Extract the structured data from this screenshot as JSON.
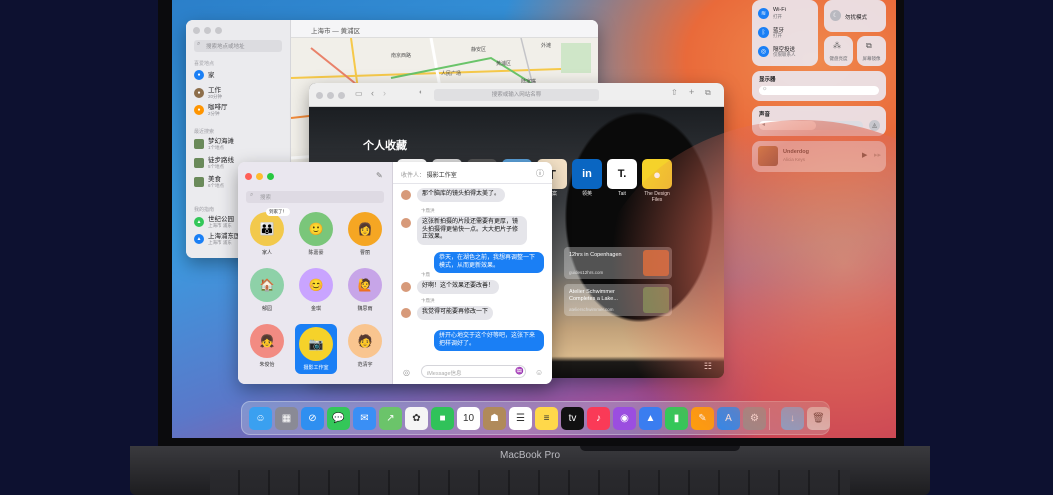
{
  "device": {
    "brand": "MacBook Pro"
  },
  "maps": {
    "search_placeholder": "搜索地点或地址",
    "title": "上海市 — 黄浦区",
    "sections": [
      "喜爱地点",
      "最近搜索",
      "我的指南"
    ],
    "favorites": [
      {
        "name": "家",
        "sub": "",
        "color": "#1a7ff5"
      },
      {
        "name": "工作",
        "sub": "20分钟",
        "color": "#8d6e4a"
      },
      {
        "name": "咖啡厅",
        "sub": "2分钟",
        "color": "#ff9500"
      }
    ],
    "recents": [
      {
        "name": "梦幻海滩",
        "sub": "1个地点"
      },
      {
        "name": "徒步路线",
        "sub": "5个地点"
      },
      {
        "name": "美食",
        "sub": "6个地点"
      }
    ],
    "guides": [
      {
        "name": "世纪公园",
        "sub": "上海市 浦东",
        "color": "#34c759"
      },
      {
        "name": "上海浦东国际机场",
        "sub": "上海市 浦东",
        "color": "#1a7ff5"
      }
    ],
    "labels": [
      "静安区",
      "黄浦区",
      "南京西路",
      "人民广场",
      "外滩",
      "陆家嘴"
    ]
  },
  "safari": {
    "url_placeholder": "搜索或输入网站名称",
    "favorites_title": "个人收藏",
    "tiles": [
      {
        "label": "",
        "bg": "#ffffff",
        "fg": "#111",
        "glyph": ""
      },
      {
        "label": "",
        "bg": "#d7d7d7",
        "fg": "#111",
        "glyph": ""
      },
      {
        "label": "",
        "bg": "#555555",
        "fg": "#fff",
        "glyph": ""
      },
      {
        "label": "",
        "bg": "#5aa0d8",
        "fg": "#fff",
        "glyph": ""
      },
      {
        "label": "文案",
        "bg": "#f3e1c6",
        "fg": "#222",
        "glyph": "T"
      },
      {
        "label": "领英",
        "bg": "#0a66c2",
        "fg": "#fff",
        "glyph": "in"
      },
      {
        "label": "Tait",
        "bg": "#ffffff",
        "fg": "#111",
        "glyph": "T."
      },
      {
        "label": "The Design Files",
        "bg": "#f5d22a",
        "fg": "#fff",
        "glyph": "●"
      }
    ],
    "cards": [
      {
        "title": "12hrs in Copenhagen",
        "sub": "guides12hrs.com",
        "img": "#c66a3a"
      },
      {
        "title": "Atelier Schwimmer Completes a Lake...",
        "sub": "atelierschwimmer.com",
        "img": "#6f8a5a"
      }
    ]
  },
  "messages": {
    "search_placeholder": "搜索",
    "to_label": "收件人：",
    "to_name": "摄影工作室",
    "compose_placeholder": "iMessage信息",
    "pins": [
      {
        "name": "家人",
        "color": "#f2c94c",
        "glyph": "👪",
        "note": "到家了！"
      },
      {
        "name": "陈嘉豪",
        "color": "#7ac67a",
        "glyph": "🙂"
      },
      {
        "name": "曹丽",
        "color": "#f5a623",
        "glyph": "👩"
      },
      {
        "name": "郁园",
        "color": "#8ed1a8",
        "glyph": "🏠"
      },
      {
        "name": "金琪",
        "color": "#c9a4ff",
        "glyph": "😊"
      },
      {
        "name": "魏思雨",
        "color": "#c7a5e8",
        "glyph": "🙋"
      },
      {
        "name": "朱俊怡",
        "color": "#f28b82",
        "glyph": "👧"
      },
      {
        "name": "摄影工作室",
        "color": "#f5d22a",
        "glyph": "📷"
      },
      {
        "name": "范清宇",
        "color": "#f9c58f",
        "glyph": "🧑"
      }
    ],
    "thread": [
      {
        "dir": "in",
        "sender": "",
        "text": "那个脑库的镜头拍得太美了。"
      },
      {
        "dir": "in",
        "sender": "卞鼎洪",
        "text": "这张新拍摄的片段还需要有更厚，镜头拍摄得更愉快一点。大大把片子修正效果。"
      },
      {
        "dir": "out",
        "sender": "",
        "text": "恭天，在湖色之前，我想再调整一下模式，从而更新效果。"
      },
      {
        "dir": "in",
        "sender": "卞鼎",
        "text": "好啊！这个效果还要改善！"
      },
      {
        "dir": "in",
        "sender": "卞鼎洪",
        "text": "我觉得可能要再修改一下"
      },
      {
        "dir": "out",
        "sender": "",
        "text": "拼开心地交于这个好等吧，这张下来把样调好了。"
      }
    ]
  },
  "control_center": {
    "wifi_label": "Wi-Fi",
    "wifi_state": "打开",
    "bluetooth_label": "蓝牙",
    "bluetooth_state": "打开",
    "airdrop_label": "隔空投送",
    "airdrop_state": "仅限联系人",
    "dnd_label": "勿扰模式",
    "keyboard_label": "键盘亮度",
    "mirror_label": "屏幕镜像",
    "display_label": "显示器",
    "display_level": 0.8,
    "sound_label": "声音",
    "sound_level": 0.55,
    "now_playing_title": "Underdog",
    "now_playing_artist": "Alicia Keys"
  },
  "dock": {
    "apps": [
      {
        "name": "finder",
        "color": "#3aa0f0",
        "glyph": "☺"
      },
      {
        "name": "launchpad",
        "color": "#8a8a95",
        "glyph": "▦"
      },
      {
        "name": "safari",
        "color": "#2f8ff0",
        "glyph": "⊘"
      },
      {
        "name": "messages",
        "color": "#34c759",
        "glyph": "💬"
      },
      {
        "name": "mail",
        "color": "#3a8ff5",
        "glyph": "✉"
      },
      {
        "name": "maps",
        "color": "#6bc46a",
        "glyph": "↗"
      },
      {
        "name": "photos",
        "color": "#f5f5f5",
        "glyph": "✿"
      },
      {
        "name": "facetime",
        "color": "#30c25a",
        "glyph": "■"
      },
      {
        "name": "calendar",
        "color": "#ffffff",
        "glyph": "10"
      },
      {
        "name": "contacts",
        "color": "#b08a5a",
        "glyph": "☗"
      },
      {
        "name": "reminders",
        "color": "#ffffff",
        "glyph": "☰"
      },
      {
        "name": "notes",
        "color": "#ffd84a",
        "glyph": "≡"
      },
      {
        "name": "tv",
        "color": "#111111",
        "glyph": "tv"
      },
      {
        "name": "music",
        "color": "#fa3a57",
        "glyph": "♪"
      },
      {
        "name": "podcasts",
        "color": "#9b4ee0",
        "glyph": "◉"
      },
      {
        "name": "keynote",
        "color": "#3a7df0",
        "glyph": "▲"
      },
      {
        "name": "numbers",
        "color": "#34c759",
        "glyph": "▮"
      },
      {
        "name": "pages",
        "color": "#ff9f0a",
        "glyph": "✎"
      },
      {
        "name": "app-store",
        "color": "#1a8cff",
        "glyph": "A"
      },
      {
        "name": "system-preferences",
        "color": "#8e8e93",
        "glyph": "⚙"
      },
      {
        "name": "downloads",
        "color": "#6bb2ef",
        "glyph": "↓"
      },
      {
        "name": "trash",
        "color": "#d8d8dd",
        "glyph": "🗑"
      }
    ]
  }
}
